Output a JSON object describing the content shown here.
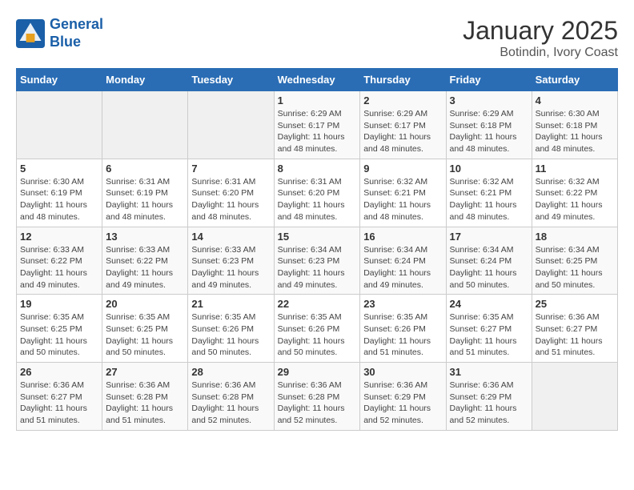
{
  "header": {
    "logo_line1": "General",
    "logo_line2": "Blue",
    "title": "January 2025",
    "subtitle": "Botindin, Ivory Coast"
  },
  "weekdays": [
    "Sunday",
    "Monday",
    "Tuesday",
    "Wednesday",
    "Thursday",
    "Friday",
    "Saturday"
  ],
  "weeks": [
    [
      {
        "day": "",
        "detail": ""
      },
      {
        "day": "",
        "detail": ""
      },
      {
        "day": "",
        "detail": ""
      },
      {
        "day": "1",
        "detail": "Sunrise: 6:29 AM\nSunset: 6:17 PM\nDaylight: 11 hours\nand 48 minutes."
      },
      {
        "day": "2",
        "detail": "Sunrise: 6:29 AM\nSunset: 6:17 PM\nDaylight: 11 hours\nand 48 minutes."
      },
      {
        "day": "3",
        "detail": "Sunrise: 6:29 AM\nSunset: 6:18 PM\nDaylight: 11 hours\nand 48 minutes."
      },
      {
        "day": "4",
        "detail": "Sunrise: 6:30 AM\nSunset: 6:18 PM\nDaylight: 11 hours\nand 48 minutes."
      }
    ],
    [
      {
        "day": "5",
        "detail": "Sunrise: 6:30 AM\nSunset: 6:19 PM\nDaylight: 11 hours\nand 48 minutes."
      },
      {
        "day": "6",
        "detail": "Sunrise: 6:31 AM\nSunset: 6:19 PM\nDaylight: 11 hours\nand 48 minutes."
      },
      {
        "day": "7",
        "detail": "Sunrise: 6:31 AM\nSunset: 6:20 PM\nDaylight: 11 hours\nand 48 minutes."
      },
      {
        "day": "8",
        "detail": "Sunrise: 6:31 AM\nSunset: 6:20 PM\nDaylight: 11 hours\nand 48 minutes."
      },
      {
        "day": "9",
        "detail": "Sunrise: 6:32 AM\nSunset: 6:21 PM\nDaylight: 11 hours\nand 48 minutes."
      },
      {
        "day": "10",
        "detail": "Sunrise: 6:32 AM\nSunset: 6:21 PM\nDaylight: 11 hours\nand 48 minutes."
      },
      {
        "day": "11",
        "detail": "Sunrise: 6:32 AM\nSunset: 6:22 PM\nDaylight: 11 hours\nand 49 minutes."
      }
    ],
    [
      {
        "day": "12",
        "detail": "Sunrise: 6:33 AM\nSunset: 6:22 PM\nDaylight: 11 hours\nand 49 minutes."
      },
      {
        "day": "13",
        "detail": "Sunrise: 6:33 AM\nSunset: 6:22 PM\nDaylight: 11 hours\nand 49 minutes."
      },
      {
        "day": "14",
        "detail": "Sunrise: 6:33 AM\nSunset: 6:23 PM\nDaylight: 11 hours\nand 49 minutes."
      },
      {
        "day": "15",
        "detail": "Sunrise: 6:34 AM\nSunset: 6:23 PM\nDaylight: 11 hours\nand 49 minutes."
      },
      {
        "day": "16",
        "detail": "Sunrise: 6:34 AM\nSunset: 6:24 PM\nDaylight: 11 hours\nand 49 minutes."
      },
      {
        "day": "17",
        "detail": "Sunrise: 6:34 AM\nSunset: 6:24 PM\nDaylight: 11 hours\nand 50 minutes."
      },
      {
        "day": "18",
        "detail": "Sunrise: 6:34 AM\nSunset: 6:25 PM\nDaylight: 11 hours\nand 50 minutes."
      }
    ],
    [
      {
        "day": "19",
        "detail": "Sunrise: 6:35 AM\nSunset: 6:25 PM\nDaylight: 11 hours\nand 50 minutes."
      },
      {
        "day": "20",
        "detail": "Sunrise: 6:35 AM\nSunset: 6:25 PM\nDaylight: 11 hours\nand 50 minutes."
      },
      {
        "day": "21",
        "detail": "Sunrise: 6:35 AM\nSunset: 6:26 PM\nDaylight: 11 hours\nand 50 minutes."
      },
      {
        "day": "22",
        "detail": "Sunrise: 6:35 AM\nSunset: 6:26 PM\nDaylight: 11 hours\nand 50 minutes."
      },
      {
        "day": "23",
        "detail": "Sunrise: 6:35 AM\nSunset: 6:26 PM\nDaylight: 11 hours\nand 51 minutes."
      },
      {
        "day": "24",
        "detail": "Sunrise: 6:35 AM\nSunset: 6:27 PM\nDaylight: 11 hours\nand 51 minutes."
      },
      {
        "day": "25",
        "detail": "Sunrise: 6:36 AM\nSunset: 6:27 PM\nDaylight: 11 hours\nand 51 minutes."
      }
    ],
    [
      {
        "day": "26",
        "detail": "Sunrise: 6:36 AM\nSunset: 6:27 PM\nDaylight: 11 hours\nand 51 minutes."
      },
      {
        "day": "27",
        "detail": "Sunrise: 6:36 AM\nSunset: 6:28 PM\nDaylight: 11 hours\nand 51 minutes."
      },
      {
        "day": "28",
        "detail": "Sunrise: 6:36 AM\nSunset: 6:28 PM\nDaylight: 11 hours\nand 52 minutes."
      },
      {
        "day": "29",
        "detail": "Sunrise: 6:36 AM\nSunset: 6:28 PM\nDaylight: 11 hours\nand 52 minutes."
      },
      {
        "day": "30",
        "detail": "Sunrise: 6:36 AM\nSunset: 6:29 PM\nDaylight: 11 hours\nand 52 minutes."
      },
      {
        "day": "31",
        "detail": "Sunrise: 6:36 AM\nSunset: 6:29 PM\nDaylight: 11 hours\nand 52 minutes."
      },
      {
        "day": "",
        "detail": ""
      }
    ]
  ]
}
